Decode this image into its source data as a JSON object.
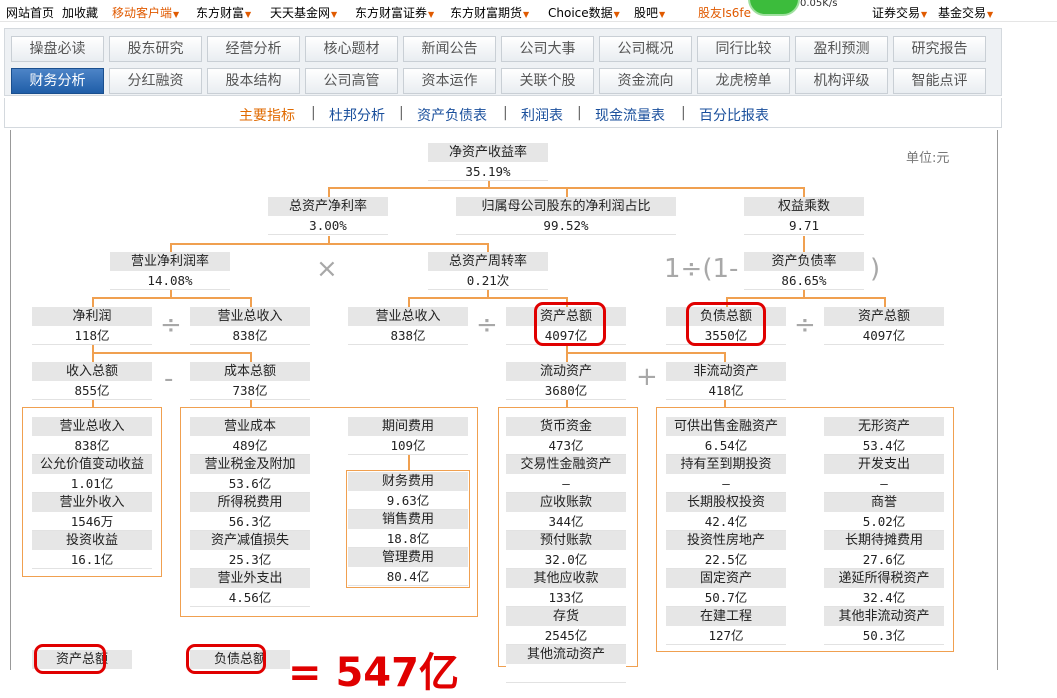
{
  "topnav": [
    {
      "label": "网站首页",
      "dropdown": false,
      "color": "black"
    },
    {
      "label": "加收藏",
      "dropdown": false,
      "color": "black"
    },
    {
      "label": "移动客户端",
      "dropdown": true,
      "color": "orange"
    },
    {
      "label": "东方财富",
      "dropdown": true,
      "color": "black"
    },
    {
      "label": "天天基金网",
      "dropdown": true,
      "color": "black"
    },
    {
      "label": "东方财富证券",
      "dropdown": true,
      "color": "black"
    },
    {
      "label": "东方财富期货",
      "dropdown": true,
      "color": "black"
    },
    {
      "label": "Choice数据",
      "dropdown": true,
      "color": "black"
    },
    {
      "label": "股吧",
      "dropdown": true,
      "color": "black"
    },
    {
      "label": "股友Is6fe",
      "dropdown": false,
      "color": "orange"
    },
    {
      "label": "证券交易",
      "dropdown": true,
      "color": "black"
    },
    {
      "label": "基金交易",
      "dropdown": true,
      "color": "black"
    }
  ],
  "speed_badge": "0.05K/s",
  "tabs_row1": [
    "操盘必读",
    "股东研究",
    "经营分析",
    "核心题材",
    "新闻公告",
    "公司大事",
    "公司概况",
    "同行比较",
    "盈利预测",
    "研究报告"
  ],
  "tabs_row2": [
    "财务分析",
    "分红融资",
    "股本结构",
    "公司高管",
    "资本运作",
    "关联个股",
    "资金流向",
    "龙虎榜单",
    "机构评级",
    "智能点评"
  ],
  "active_tab": "财务分析",
  "subtabs": [
    "主要指标",
    "杜邦分析",
    "资产负债表",
    "利润表",
    "现金流量表",
    "百分比报表"
  ],
  "active_subtab": "主要指标",
  "unit": "单位:元",
  "colors": {
    "accent_line": "#f0a050",
    "highlight": "#e00000",
    "active_tab": "#2a67b0",
    "active_sub": "#e06a00"
  },
  "operators": {
    "times": "×",
    "divide": "÷",
    "minus": "-",
    "plus": "+",
    "one_div": "1÷(1-",
    "close": ")"
  },
  "big_annotation": "= 547亿",
  "nodes": {
    "roe": {
      "label": "净资产收益率",
      "value": "35.19%"
    },
    "roa": {
      "label": "总资产净利率",
      "value": "3.00%"
    },
    "parent_ratio": {
      "label": "归属母公司股东的净利润占比",
      "value": "99.52%"
    },
    "equity_mult": {
      "label": "权益乘数",
      "value": "9.71"
    },
    "net_margin": {
      "label": "营业净利润率",
      "value": "14.08%"
    },
    "asset_turnover": {
      "label": "总资产周转率",
      "value": "0.21次"
    },
    "debt_ratio": {
      "label": "资产负债率",
      "value": "86.65%"
    },
    "net_profit": {
      "label": "净利润",
      "value": "118亿"
    },
    "revenue_a": {
      "label": "营业总收入",
      "value": "838亿"
    },
    "revenue_b": {
      "label": "营业总收入",
      "value": "838亿"
    },
    "total_assets_a": {
      "label": "资产总额",
      "value": "4097亿"
    },
    "total_liab": {
      "label": "负债总额",
      "value": "3550亿"
    },
    "total_assets_b": {
      "label": "资产总额",
      "value": "4097亿"
    },
    "total_income": {
      "label": "收入总额",
      "value": "855亿"
    },
    "total_cost": {
      "label": "成本总额",
      "value": "738亿"
    },
    "current_assets": {
      "label": "流动资产",
      "value": "3680亿"
    },
    "noncurrent_assets": {
      "label": "非流动资产",
      "value": "418亿"
    },
    "period_expense": {
      "label": "期间费用",
      "value": "109亿"
    },
    "bottom_assets": {
      "label": "资产总额"
    },
    "bottom_liab": {
      "label": "负债总额"
    }
  },
  "income_items": [
    {
      "label": "营业总收入",
      "value": "838亿"
    },
    {
      "label": "公允价值变动收益",
      "value": "1.01亿"
    },
    {
      "label": "营业外收入",
      "value": "1546万"
    },
    {
      "label": "投资收益",
      "value": "16.1亿"
    }
  ],
  "cost_items": [
    {
      "label": "营业成本",
      "value": "489亿"
    },
    {
      "label": "营业税金及附加",
      "value": "53.6亿"
    },
    {
      "label": "所得税费用",
      "value": "56.3亿"
    },
    {
      "label": "资产减值损失",
      "value": "25.3亿"
    },
    {
      "label": "营业外支出",
      "value": "4.56亿"
    }
  ],
  "expense_items": [
    {
      "label": "财务费用",
      "value": "9.63亿"
    },
    {
      "label": "销售费用",
      "value": "18.8亿"
    },
    {
      "label": "管理费用",
      "value": "80.4亿"
    }
  ],
  "current_items": [
    {
      "label": "货币资金",
      "value": "473亿"
    },
    {
      "label": "交易性金融资产",
      "value": "—"
    },
    {
      "label": "应收账款",
      "value": "344亿"
    },
    {
      "label": "预付账款",
      "value": "32.0亿"
    },
    {
      "label": "其他应收款",
      "value": "133亿"
    },
    {
      "label": "存货",
      "value": "2545亿"
    },
    {
      "label": "其他流动资产",
      "value": ""
    }
  ],
  "noncurrent_left": [
    {
      "label": "可供出售金融资产",
      "value": "6.54亿"
    },
    {
      "label": "持有至到期投资",
      "value": "—"
    },
    {
      "label": "长期股权投资",
      "value": "42.4亿"
    },
    {
      "label": "投资性房地产",
      "value": "22.5亿"
    },
    {
      "label": "固定资产",
      "value": "50.7亿"
    },
    {
      "label": "在建工程",
      "value": "127亿"
    }
  ],
  "noncurrent_right": [
    {
      "label": "无形资产",
      "value": "53.4亿"
    },
    {
      "label": "开发支出",
      "value": "—"
    },
    {
      "label": "商誉",
      "value": "5.02亿"
    },
    {
      "label": "长期待摊费用",
      "value": "27.6亿"
    },
    {
      "label": "递延所得税资产",
      "value": "32.4亿"
    },
    {
      "label": "其他非流动资产",
      "value": "50.3亿"
    }
  ]
}
